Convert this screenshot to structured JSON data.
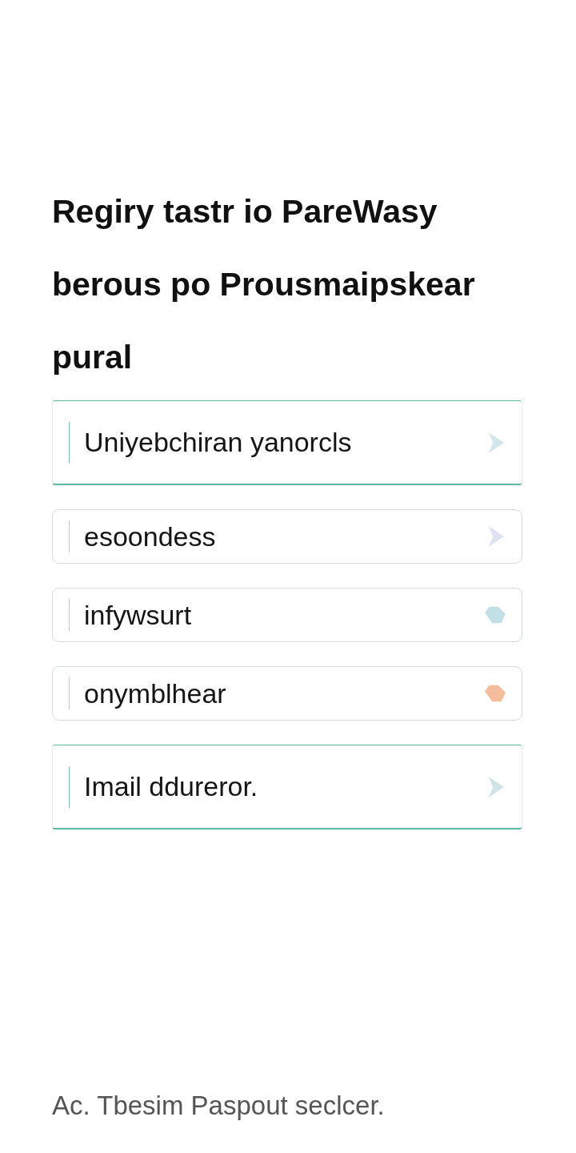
{
  "title": "Regiry tastr io PareWasy\nberous po Prousmaipskear\npural",
  "fields": [
    {
      "value": "Uniyebchiran yanorcls",
      "focused": true,
      "kind": "chevron",
      "color": "#d3e6ec"
    },
    {
      "value": "esoondess",
      "focused": false,
      "kind": "chevron",
      "color": "#dde3f0"
    },
    {
      "value": "infywsurt",
      "focused": false,
      "kind": "tag",
      "color": "#c3dfe6"
    },
    {
      "value": "onymblhear",
      "focused": false,
      "kind": "tag",
      "color": "#f4bc9a"
    },
    {
      "value": "Imail ddureror.",
      "focused": true,
      "kind": "chevron",
      "color": "#d0e4e8"
    }
  ],
  "footer": "Ac. Tbesim Paspout seclcer."
}
